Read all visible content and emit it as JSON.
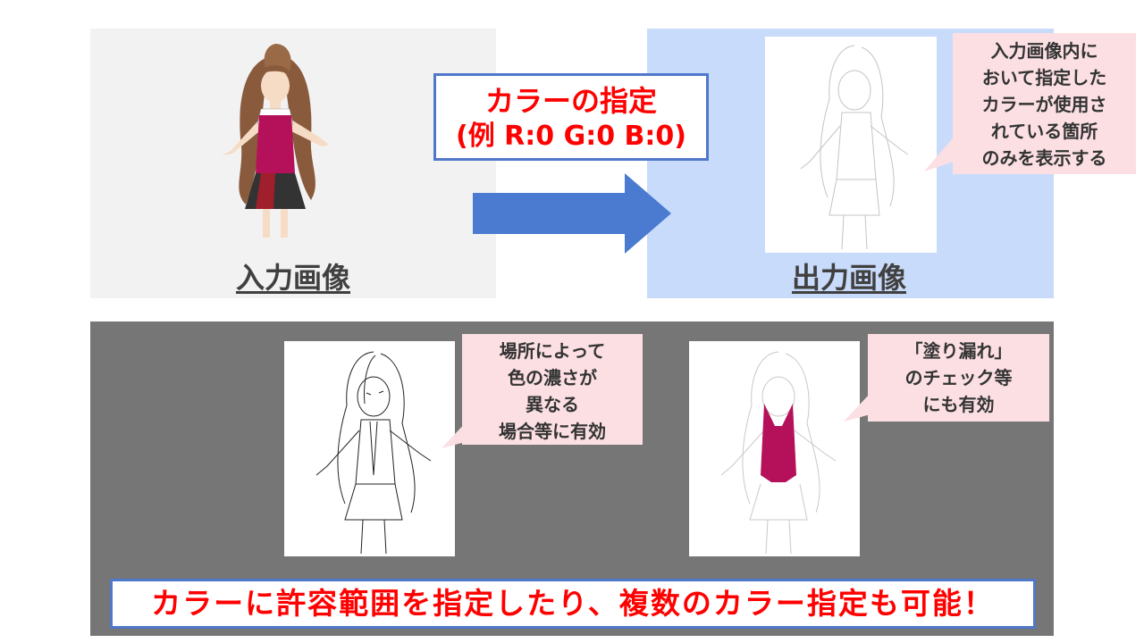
{
  "top": {
    "input_caption": "入力画像",
    "output_caption": "出力画像",
    "spec_title": "カラーの指定",
    "spec_example": "(例 R:0 G:0 B:0)",
    "callout_output_lines": [
      "入力画像内に",
      "おいて指定した",
      "カラーが使用さ",
      "れている箇所",
      "のみを表示する"
    ]
  },
  "bottom": {
    "callout_left_lines": [
      "場所によって",
      "色の濃さが",
      "異なる",
      "場合等に有効"
    ],
    "callout_right_lines": [
      "「塗り漏れ」",
      "のチェック等",
      "にも有効"
    ],
    "banner": "カラーに許容範囲を指定したり、複数のカラー指定も可能！"
  },
  "colors": {
    "accent_blue": "#4f78c9",
    "arrow_blue": "#4a7bd0",
    "alert_red": "#ff0000",
    "callout_pink": "#fbdfe3",
    "vest_magenta": "#b5105a"
  }
}
